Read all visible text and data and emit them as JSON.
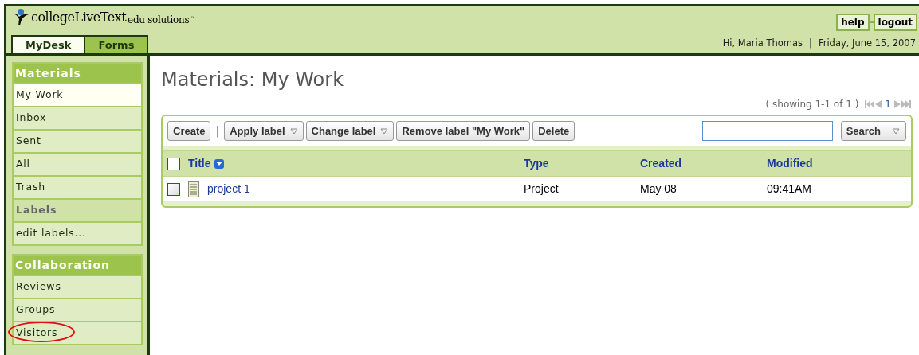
{
  "header": {
    "logo_main": "collegeLiveText",
    "logo_sub": "edu solutions",
    "trademark": "™",
    "links": [
      "help",
      "logout"
    ],
    "greeting": "Hi, Maria Thomas",
    "separator": "|",
    "date": "Friday, June 15, 2007"
  },
  "tabs": [
    {
      "label": "MyDesk",
      "selected": true
    },
    {
      "label": "Forms",
      "selected": false
    }
  ],
  "sidebar": [
    {
      "title": "Materials",
      "items": [
        {
          "label": "My Work",
          "kind": "item",
          "selected": true,
          "circled": false
        },
        {
          "label": "Inbox",
          "kind": "item",
          "selected": false,
          "circled": false
        },
        {
          "label": "Sent",
          "kind": "item",
          "selected": false,
          "circled": false
        },
        {
          "label": "All",
          "kind": "item",
          "selected": false,
          "circled": false
        },
        {
          "label": "Trash",
          "kind": "item",
          "selected": false,
          "circled": false
        },
        {
          "label": "Labels",
          "kind": "subheader"
        },
        {
          "label": "edit labels...",
          "kind": "item",
          "selected": false,
          "circled": false
        }
      ]
    },
    {
      "title": "Collaboration",
      "items": [
        {
          "label": "Reviews",
          "kind": "item",
          "selected": false,
          "circled": false
        },
        {
          "label": "Groups",
          "kind": "item",
          "selected": false,
          "circled": false
        },
        {
          "label": "Visitors",
          "kind": "item",
          "selected": false,
          "circled": true
        }
      ]
    }
  ],
  "page_title": "Materials: My Work",
  "showing": "( showing 1-1 of 1 )",
  "page_number": "1",
  "toolbar": [
    {
      "label": "Create",
      "kind": "button"
    },
    {
      "kind": "separator",
      "label": "|"
    },
    {
      "label": "Apply label",
      "kind": "dropdown"
    },
    {
      "label": "Change label",
      "kind": "dropdown"
    },
    {
      "label": "Remove label \"My Work\"",
      "kind": "button"
    },
    {
      "label": "Delete",
      "kind": "button"
    }
  ],
  "search_button": "Search",
  "table": {
    "all_checked": false,
    "columns": [
      "Title",
      "Type",
      "Created",
      "Modified"
    ],
    "rows": [
      {
        "checked": false,
        "cells": [
          "project 1",
          "Project",
          "May 08",
          "09:41AM"
        ]
      }
    ]
  }
}
